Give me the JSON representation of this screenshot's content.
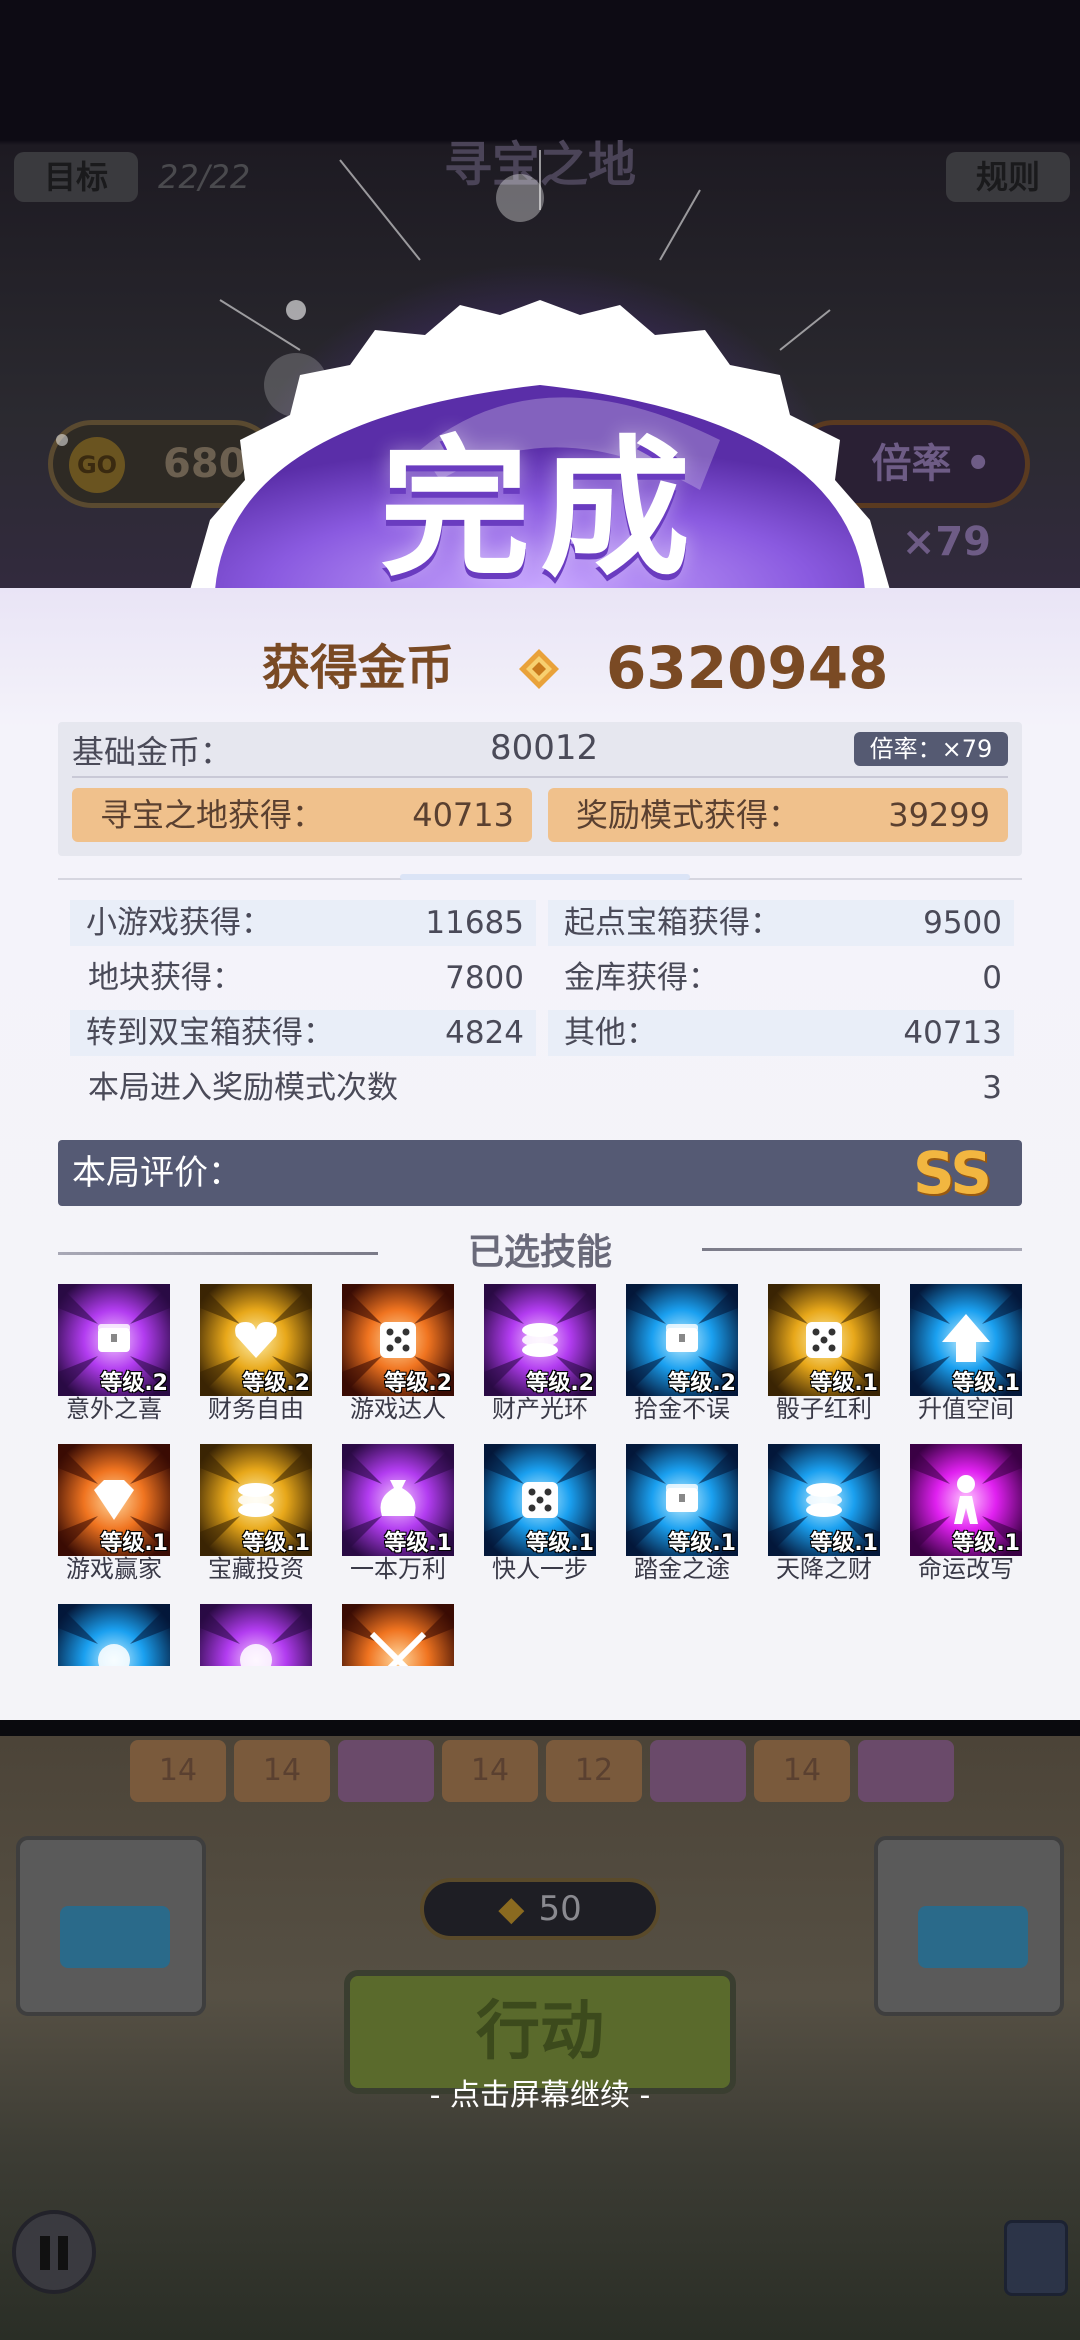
{
  "hud": {
    "target_label": "目标",
    "progress": "22/22",
    "title": "寻宝之地",
    "rules_label": "规则",
    "coins_icon": "GO",
    "coins_value": "6800",
    "multiplier": "倍率 • ×79"
  },
  "completion_badge": "完成",
  "result": {
    "coins_label": "获得金币",
    "coins_value": "6320948",
    "base_label": "基础金币：",
    "base_value": "80012",
    "multiplier_tag": "倍率：×79",
    "treasure_label": "寻宝之地获得：",
    "treasure_value": "40713",
    "reward_label": "奖励模式获得：",
    "reward_value": "39299",
    "stats": [
      {
        "label": "小游戏获得：",
        "value": "11685"
      },
      {
        "label": "起点宝箱获得：",
        "value": "9500"
      },
      {
        "label": "地块获得：",
        "value": "7800"
      },
      {
        "label": "金库获得：",
        "value": "0"
      },
      {
        "label": "转到双宝箱获得：",
        "value": "4824"
      },
      {
        "label": "其他：",
        "value": "40713"
      },
      {
        "label": "本局进入奖励模式次数",
        "value": "3"
      }
    ],
    "rating_label": "本局评价：",
    "rating_grade": "SS"
  },
  "skills_title": "已选技能",
  "skills": [
    {
      "name": "意外之喜",
      "level": "等级.2",
      "theme": "purple",
      "icon": "chest-icon"
    },
    {
      "name": "财务自由",
      "level": "等级.2",
      "theme": "gold",
      "icon": "heart-paw-icon"
    },
    {
      "name": "游戏达人",
      "level": "等级.2",
      "theme": "orange",
      "icon": "dice-icon"
    },
    {
      "name": "财产光环",
      "level": "等级.2",
      "theme": "purple",
      "icon": "coin-stack-icon"
    },
    {
      "name": "拾金不误",
      "level": "等级.2",
      "theme": "blue",
      "icon": "chest-icon"
    },
    {
      "name": "骰子红利",
      "level": "等级.1",
      "theme": "gold",
      "icon": "dice-icon"
    },
    {
      "name": "升值空间",
      "level": "等级.1",
      "theme": "blue",
      "icon": "arrow-up-icon"
    },
    {
      "name": "游戏赢家",
      "level": "等级.1",
      "theme": "orange",
      "icon": "diamond-icon"
    },
    {
      "name": "宝藏投资",
      "level": "等级.1",
      "theme": "gold",
      "icon": "coin-stack-icon"
    },
    {
      "name": "一本万利",
      "level": "等级.1",
      "theme": "purple",
      "icon": "money-bag-icon"
    },
    {
      "name": "快人一步",
      "level": "等级.1",
      "theme": "blue",
      "icon": "dice-icon"
    },
    {
      "name": "踏金之途",
      "level": "等级.1",
      "theme": "blue",
      "icon": "chest-icon"
    },
    {
      "name": "天降之财",
      "level": "等级.1",
      "theme": "blue",
      "icon": "coin-stack-icon"
    },
    {
      "name": "命运改写",
      "level": "等级.1",
      "theme": "magenta",
      "icon": "person-icon"
    },
    {
      "name": "",
      "level": "",
      "theme": "blue",
      "icon": "orb-icon"
    },
    {
      "name": "",
      "level": "",
      "theme": "purple",
      "icon": "orb-icon"
    },
    {
      "name": "",
      "level": "",
      "theme": "orange",
      "icon": "crossed-swords-icon"
    }
  ],
  "bottom": {
    "tiles": [
      "14",
      "14",
      "",
      "14",
      "12",
      "",
      "14",
      ""
    ],
    "cost_value": "50",
    "action_label": "行动",
    "continue_hint": "- 点击屏幕继续 -"
  },
  "colors": {
    "panel_bg": "#f4f4f8",
    "accent_purple": "#8a5ae0",
    "chip_orange": "#f0c18c",
    "rating_bar": "#555a74",
    "coin_text": "#7a4a24"
  }
}
